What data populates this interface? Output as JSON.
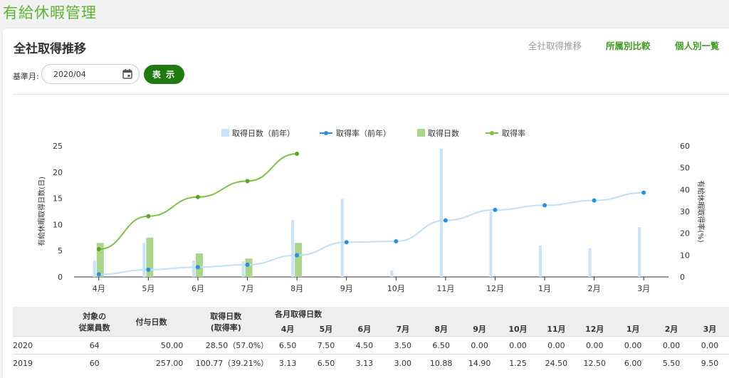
{
  "app": {
    "title": "有給休暇管理"
  },
  "page": {
    "title": "全社取得推移"
  },
  "nav": {
    "current": "全社取得推移",
    "by_dept": "所属別比較",
    "by_person": "個人別一覧"
  },
  "filter": {
    "label": "基準月:",
    "month_value": "2020/04",
    "show_label": "表 示"
  },
  "colors": {
    "prev_bar": "#c6e3fb",
    "prev_line": "#2a8fdd",
    "prev_line_soft": "#bfe0f8",
    "cur_bar": "#a9d68a",
    "cur_line": "#7ec043"
  },
  "chart_data": {
    "type": "bar+line",
    "categories": [
      "4月",
      "5月",
      "6月",
      "7月",
      "8月",
      "9月",
      "10月",
      "11月",
      "12月",
      "1月",
      "2月",
      "3月"
    ],
    "ylabel": "有給休暇取得日数(日)",
    "y2label": "有給休暇取得率(%)",
    "ylim": [
      0,
      25
    ],
    "y2lim": [
      0,
      60
    ],
    "yticks": [
      "0",
      "5",
      "10",
      "15",
      "20",
      "25"
    ],
    "y2ticks": [
      "0",
      "10",
      "20",
      "30",
      "40",
      "50",
      "60"
    ],
    "legend_position": "top",
    "series": [
      {
        "name": "取得日数（前年）",
        "kind": "bar",
        "axis": "left",
        "values": [
          3.13,
          6.5,
          3.13,
          3.0,
          10.88,
          14.9,
          1.25,
          24.5,
          12.5,
          6.0,
          5.5,
          9.5
        ]
      },
      {
        "name": "取得率（前年）",
        "kind": "line",
        "axis": "right",
        "values": [
          1.2,
          3.3,
          4.5,
          5.6,
          9.9,
          15.9,
          16.3,
          25.9,
          30.7,
          32.8,
          35.0,
          38.6
        ]
      },
      {
        "name": "取得日数",
        "kind": "bar",
        "axis": "left",
        "values": [
          6.5,
          7.5,
          4.5,
          3.5,
          6.5,
          null,
          null,
          null,
          null,
          null,
          null,
          null
        ]
      },
      {
        "name": "取得率",
        "kind": "line",
        "axis": "right",
        "values": [
          12.7,
          27.8,
          36.6,
          43.9,
          56.4,
          null,
          null,
          null,
          null,
          null,
          null,
          null
        ]
      }
    ]
  },
  "table": {
    "headers": {
      "employees": [
        "対象の",
        "従業員数"
      ],
      "granted": "付与日数",
      "taken": [
        "取得日数",
        "(取得率)"
      ],
      "monthly": "各月取得日数"
    },
    "months": [
      "4月",
      "5月",
      "6月",
      "7月",
      "8月",
      "9月",
      "10月",
      "11月",
      "12月",
      "1月",
      "2月",
      "3月"
    ],
    "rows": [
      {
        "year": "2020",
        "employees": "64",
        "granted": "50.00",
        "taken": "28.50（57.0%）",
        "monthly": [
          "6.50",
          "7.50",
          "4.50",
          "3.50",
          "6.50",
          "0.00",
          "0.00",
          "0.00",
          "0.00",
          "0.00",
          "0.00",
          "0.00"
        ]
      },
      {
        "year": "2019",
        "employees": "60",
        "granted": "257.00",
        "taken": "100.77（39.21%）",
        "monthly": [
          "3.13",
          "6.50",
          "3.13",
          "3.00",
          "10.88",
          "14.90",
          "1.25",
          "24.50",
          "12.50",
          "6.00",
          "5.50",
          "9.50"
        ]
      }
    ]
  }
}
